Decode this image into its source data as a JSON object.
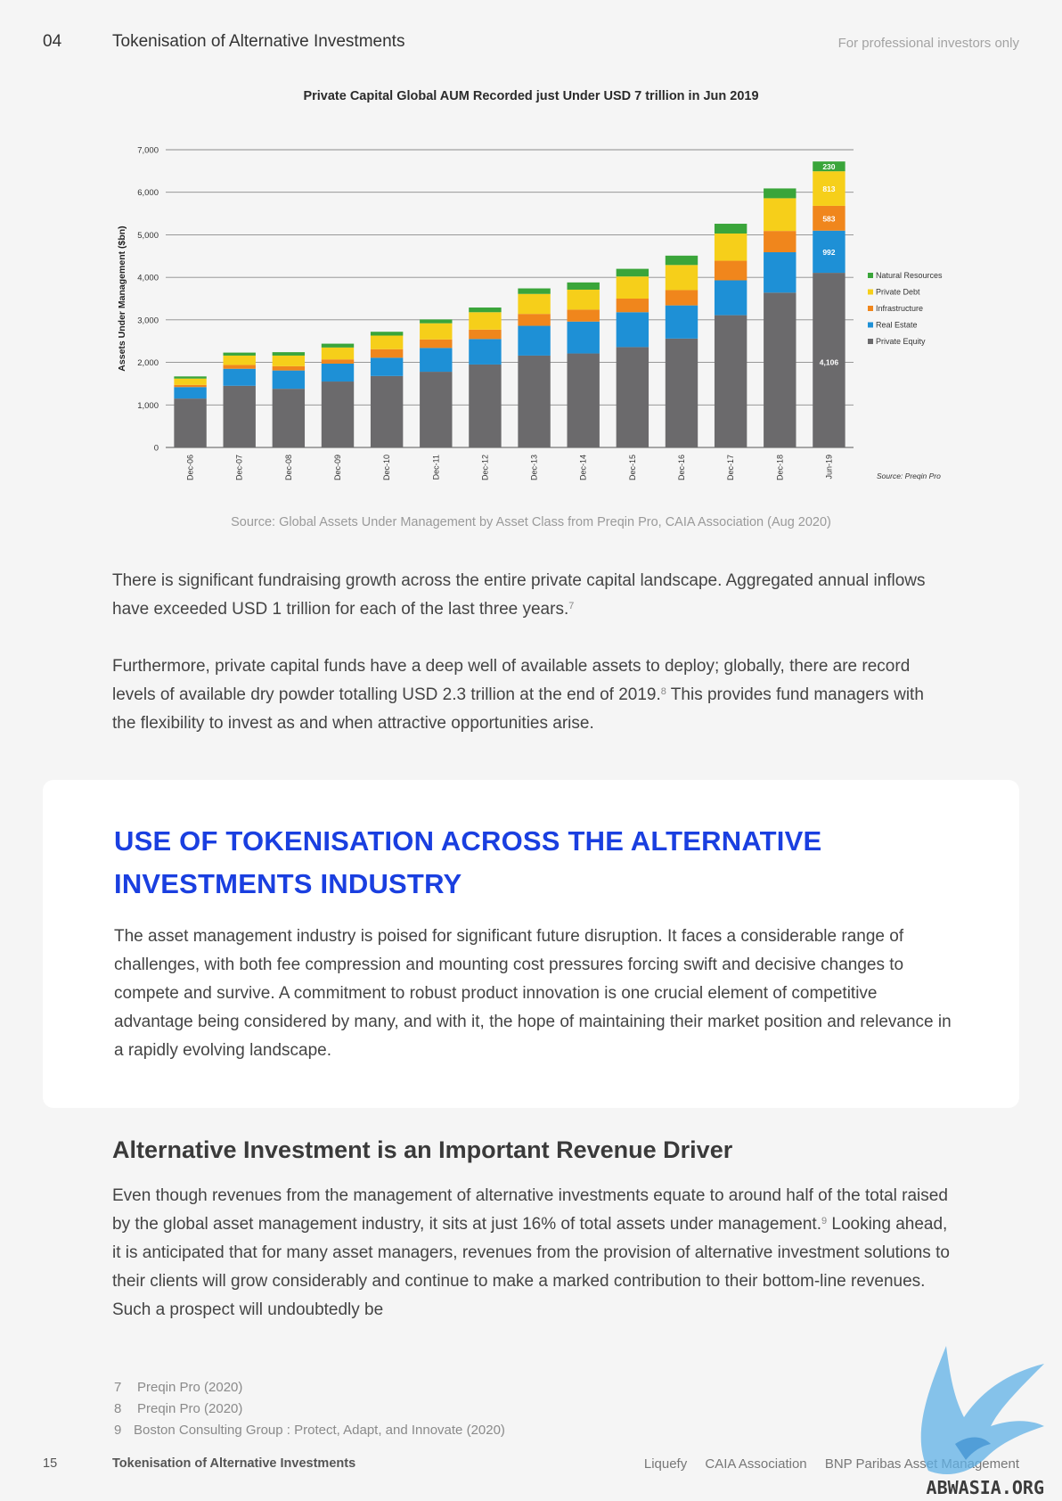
{
  "header": {
    "page_section": "04",
    "title": "Tokenisation of Alternative Investments",
    "audience_note": "For professional investors only"
  },
  "figure": {
    "title": "Private Capital Global AUM Recorded just Under USD 7 trillion in Jun 2019",
    "source_caption": "Source:  Global Assets Under Management by Asset Class from Preqin Pro, CAIA Association (Aug 2020)"
  },
  "chart_data": {
    "type": "bar",
    "stacked": true,
    "ylabel": "Assets Under Management ($bn)",
    "ylim": [
      0,
      7000
    ],
    "yticks": [
      "0",
      "1,000",
      "2,000",
      "3,000",
      "4,000",
      "5,000",
      "6,000",
      "7,000"
    ],
    "ytick_values": [
      0,
      1000,
      2000,
      3000,
      4000,
      5000,
      6000,
      7000
    ],
    "grid": true,
    "legend_position": "right",
    "inner_source": "Source: Preqin Pro",
    "categories": [
      "Dec-06",
      "Dec-07",
      "Dec-08",
      "Dec-09",
      "Dec-10",
      "Dec-11",
      "Dec-12",
      "Dec-13",
      "Dec-14",
      "Dec-15",
      "Dec-16",
      "Dec-17",
      "Dec-18",
      "Jun-19"
    ],
    "series": [
      {
        "name": "Private Equity",
        "color": "#6b6a6c",
        "values": [
          1150,
          1450,
          1380,
          1550,
          1680,
          1780,
          1950,
          2160,
          2210,
          2360,
          2560,
          3110,
          3640,
          4106
        ]
      },
      {
        "name": "Real Estate",
        "color": "#1e90d6",
        "values": [
          270,
          400,
          430,
          420,
          430,
          560,
          600,
          700,
          750,
          820,
          780,
          820,
          950,
          992
        ]
      },
      {
        "name": "Infrastructure",
        "color": "#f0861c",
        "values": [
          50,
          90,
          100,
          100,
          200,
          200,
          220,
          280,
          280,
          320,
          360,
          460,
          500,
          583
        ]
      },
      {
        "name": "Private Debt",
        "color": "#f6cf1a",
        "values": [
          150,
          220,
          250,
          280,
          320,
          380,
          410,
          470,
          470,
          520,
          590,
          640,
          770,
          813
        ]
      },
      {
        "name": "Natural Resources",
        "color": "#3aa53a",
        "values": [
          50,
          70,
          80,
          90,
          90,
          90,
          110,
          130,
          170,
          180,
          220,
          230,
          230,
          230
        ]
      }
    ],
    "legend_order": [
      "Natural Resources",
      "Private Debt",
      "Infrastructure",
      "Real Estate",
      "Private Equity"
    ],
    "data_labels": {
      "category": "Jun-19",
      "values": [
        "230",
        "813",
        "583",
        "992",
        "4,106"
      ]
    }
  },
  "paragraphs": {
    "p1_text": "There is significant fundraising growth across the entire private capital landscape. Aggregated annual inflows have exceeded USD 1 trillion for each of the last three years.",
    "p1_ref": "7",
    "p2_text_a": "Furthermore, private capital funds have a deep well of available assets to deploy; globally, there are record levels of available dry powder totalling USD 2.3 trillion at the end of 2019.",
    "p2_ref": "8",
    "p2_text_b": " This provides fund managers with the flexibility to invest as and when attractive opportunities arise."
  },
  "card": {
    "title": "USE OF TOKENISATION ACROSS THE ALTERNATIVE INVESTMENTS INDUSTRY",
    "text": "The asset management industry is poised for significant future disruption. It faces a considerable range of challenges, with both fee compression and mounting cost pressures forcing swift and decisive changes to compete and survive. A commitment to robust product innovation is one crucial element of competitive advantage being considered by many, and with it, the hope of maintaining their market position and relevance in a rapidly evolving landscape."
  },
  "section": {
    "heading": "Alternative Investment is an Important Revenue Driver",
    "text_a": "Even though revenues from the management of alternative investments equate to around half of the total raised by the global asset management industry, it sits at just 16% of total assets under management.",
    "ref": "9",
    "text_b": " Looking ahead, it is anticipated that for many asset managers, revenues from the provision of alternative investment solutions to their clients will grow considerably and continue to make a marked contribution to their bottom-line revenues. Such a prospect will undoubtedly be"
  },
  "footnotes": [
    {
      "num": "7",
      "text": "Preqin Pro (2020)"
    },
    {
      "num": "8",
      "text": "Preqin Pro (2020)"
    },
    {
      "num": "9",
      "text": "Boston Consulting Group : Protect, Adapt, and Innovate (2020)"
    }
  ],
  "footer": {
    "page_number": "15",
    "title": "Tokenisation of Alternative Investments",
    "partner_1": "Liquefy",
    "partner_2": "CAIA Association",
    "partner_3": "BNP Paribas Asset Management"
  },
  "watermark": {
    "text": "ABWASIA.ORG",
    "icon": "bird-logo-icon"
  }
}
